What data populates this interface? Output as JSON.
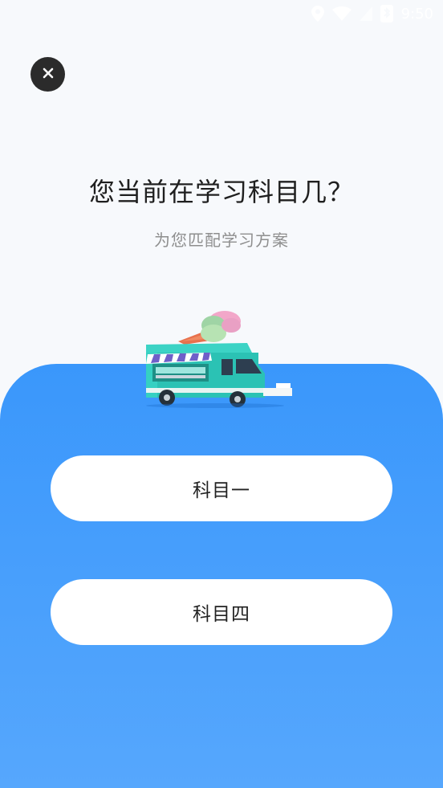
{
  "status_bar": {
    "time": "9:50",
    "icons": [
      "location-icon",
      "wifi-icon",
      "signal-icon",
      "bluetooth-icon"
    ]
  },
  "close": {
    "icon": "close-icon"
  },
  "header": {
    "title": "您当前在学习科目几？",
    "subtitle": "为您匹配学习方案"
  },
  "illustration": {
    "icon": "ice-cream-truck-illustration"
  },
  "options": [
    {
      "label": "科目一"
    },
    {
      "label": "科目四"
    }
  ],
  "colors": {
    "background": "#f7f9fc",
    "panel_top": "#3a97fb",
    "panel_bottom": "#56a7fd",
    "close_button": "#2b2b2b",
    "title_text": "#1f1f1f",
    "subtitle_text": "#8e8e8e"
  }
}
